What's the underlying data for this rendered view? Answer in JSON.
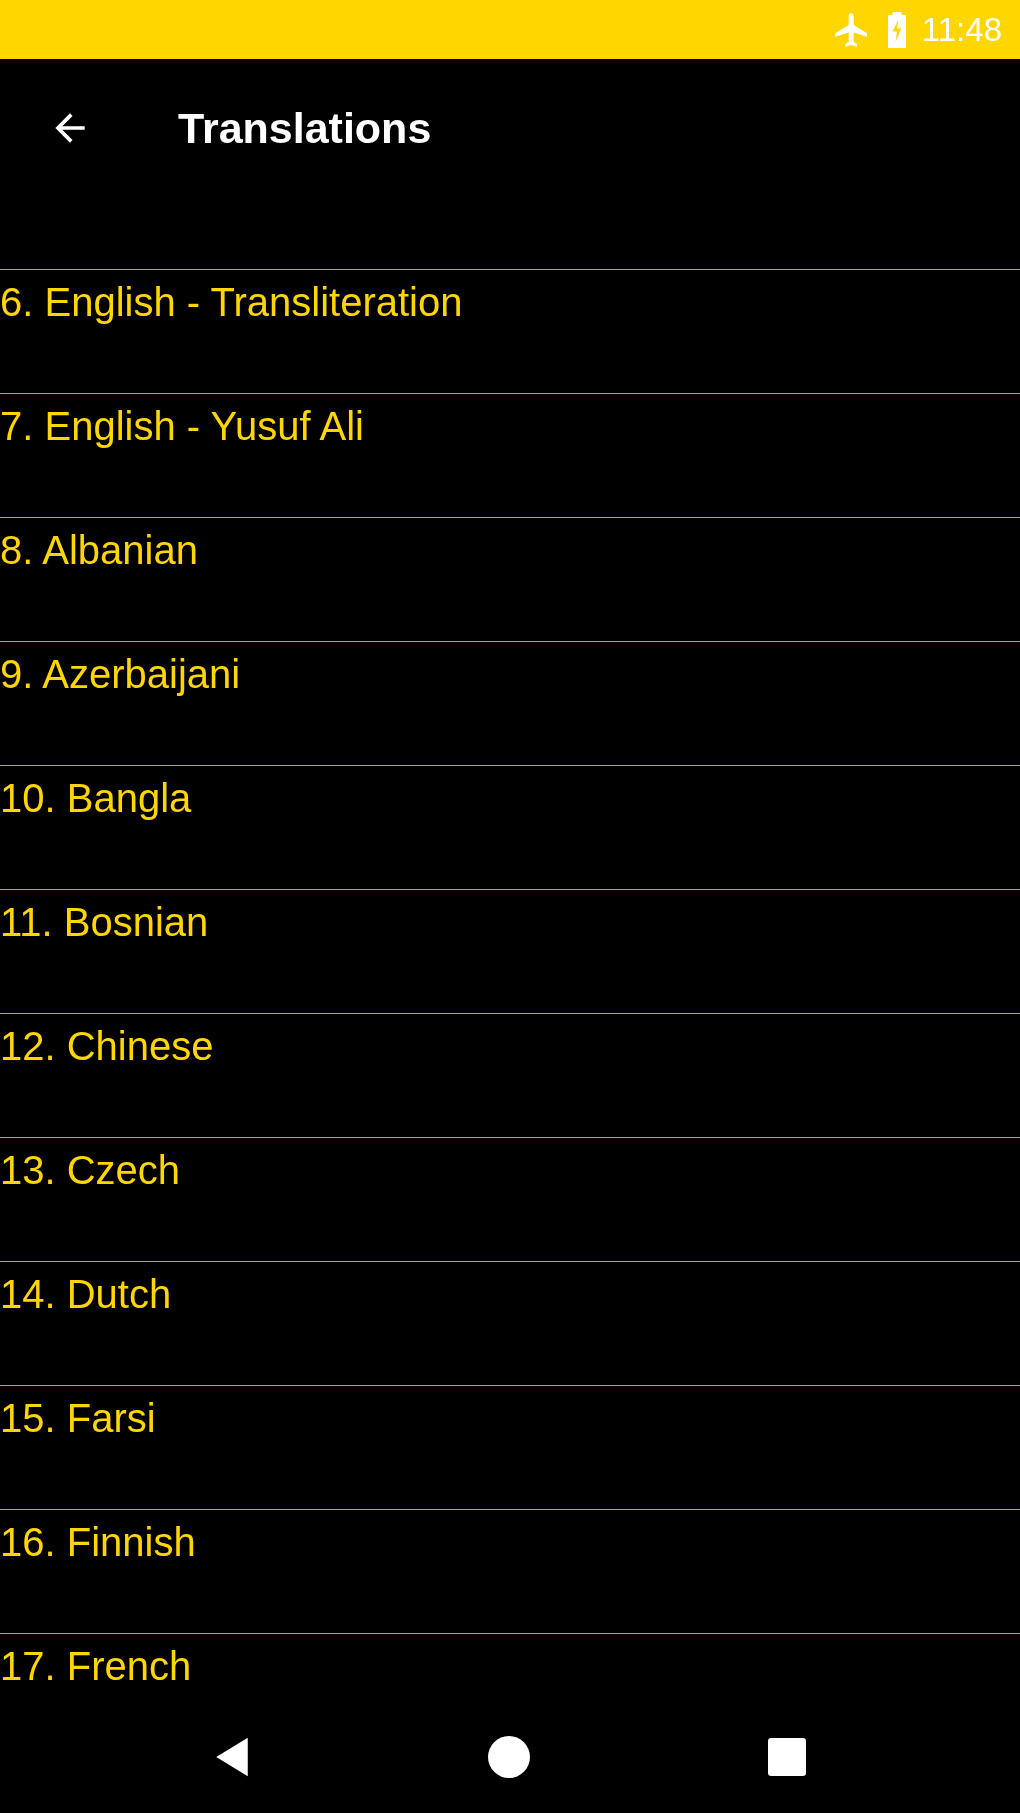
{
  "status_bar": {
    "time": "11:48"
  },
  "toolbar": {
    "title": "Translations"
  },
  "translations": [
    {
      "label": "6. English - Transliteration"
    },
    {
      "label": "7. English - Yusuf Ali"
    },
    {
      "label": "8. Albanian"
    },
    {
      "label": "9. Azerbaijani"
    },
    {
      "label": "10. Bangla"
    },
    {
      "label": "11. Bosnian"
    },
    {
      "label": "12. Chinese"
    },
    {
      "label": "13. Czech"
    },
    {
      "label": "14. Dutch"
    },
    {
      "label": "15. Farsi"
    },
    {
      "label": "16. Finnish"
    },
    {
      "label": "17. French"
    }
  ]
}
